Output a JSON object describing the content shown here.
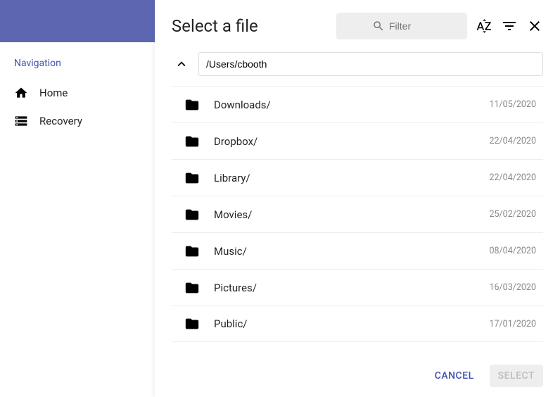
{
  "sidebar": {
    "nav_title": "Navigation",
    "items": [
      {
        "label": "Home",
        "icon": "home"
      },
      {
        "label": "Recovery",
        "icon": "storage"
      }
    ]
  },
  "dialog": {
    "title": "Select a file",
    "filter_placeholder": "Filter",
    "path": "/Users/cbooth",
    "files": [
      {
        "name": "Downloads/",
        "date": "11/05/2020"
      },
      {
        "name": "Dropbox/",
        "date": "22/04/2020"
      },
      {
        "name": "Library/",
        "date": "22/04/2020"
      },
      {
        "name": "Movies/",
        "date": "25/02/2020"
      },
      {
        "name": "Music/",
        "date": "08/04/2020"
      },
      {
        "name": "Pictures/",
        "date": "16/03/2020"
      },
      {
        "name": "Public/",
        "date": "17/01/2020"
      }
    ],
    "cancel_label": "Cancel",
    "select_label": "Select"
  }
}
